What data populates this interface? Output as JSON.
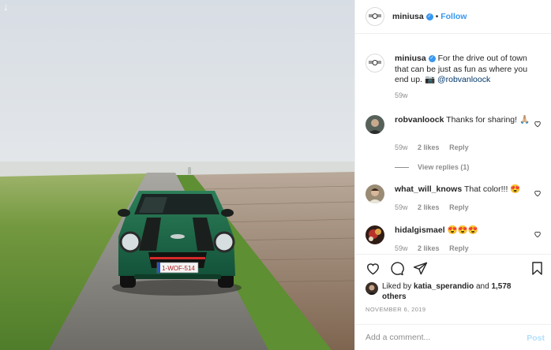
{
  "post": {
    "username": "miniusa",
    "follow_label": "Follow",
    "dot": "•",
    "caption_text": "For the drive out of town that can be just as fun as where you end up. 📷",
    "caption_mention": "@robvanloock",
    "caption_age": "59w",
    "license_plate": "1-WOF-514"
  },
  "comments": [
    {
      "user": "robvanloock",
      "text": "Thanks for sharing! 🙏🏼",
      "age": "59w",
      "likes": "2 likes",
      "reply": "Reply",
      "view_replies": "View replies (1)"
    },
    {
      "user": "what_will_knows",
      "text": "That color!!! 😍",
      "age": "59w",
      "likes": "2 likes",
      "reply": "Reply"
    },
    {
      "user": "hidalgismael",
      "text": "😍😍😍",
      "age": "59w",
      "likes": "2 likes",
      "reply": "Reply"
    }
  ],
  "likes": {
    "prefix": "Liked by",
    "user": "katia_sperandio",
    "and": "and",
    "others": "1,578 others"
  },
  "date": "NOVEMBER 6, 2019",
  "comment_box": {
    "placeholder": "Add a comment...",
    "post_label": "Post"
  },
  "icons": {
    "download": "download-arrow-icon",
    "like": "heart-icon",
    "comment": "comment-bubble-icon",
    "share": "paper-plane-icon",
    "save": "bookmark-icon"
  },
  "colors": {
    "link": "#3897f0",
    "muted": "#8e8e8e",
    "post_disabled": "#b2dffc",
    "car_green": "#1f6b4a"
  }
}
